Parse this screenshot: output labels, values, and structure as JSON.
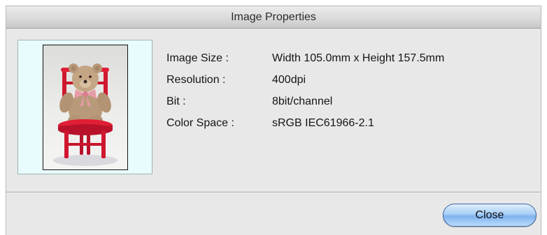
{
  "dialog": {
    "title": "Image Properties"
  },
  "properties": [
    {
      "label": "Image Size :",
      "value": "Width 105.0mm x Height 157.5mm"
    },
    {
      "label": "Resolution :",
      "value": "400dpi"
    },
    {
      "label": "Bit :",
      "value": "8bit/channel"
    },
    {
      "label": "Color Space :",
      "value": "sRGB IEC61966-2.1"
    }
  ],
  "buttons": {
    "close_label": "Close"
  },
  "colors": {
    "preview_background": "#e9fcfd",
    "close_button_accent": "#7fb3ef"
  }
}
